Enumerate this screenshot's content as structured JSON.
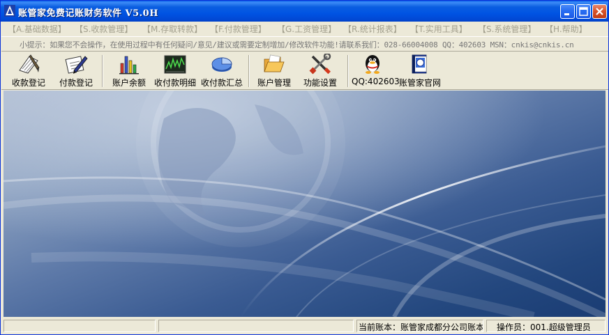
{
  "window": {
    "title": "账管家免费记账财务软件  V5.0H"
  },
  "menu": [
    {
      "label": "【A.基础数据】"
    },
    {
      "label": "【S.收款管理】"
    },
    {
      "label": "【M.存取转款】"
    },
    {
      "label": "【F.付款管理】"
    },
    {
      "label": "【G.工资管理】"
    },
    {
      "label": "【R.统计报表】"
    },
    {
      "label": "【T.实用工具】"
    },
    {
      "label": "【S.系统管理】"
    },
    {
      "label": "【H.帮助】"
    }
  ],
  "hint": {
    "text": "小提示：如果您不会操作，在使用过程中有任何疑问/意见/建议或需要定制增加/修改软件功能!请联系我们：028-66004008 QQ：402603 MSN：cnkis@cnkis.cn"
  },
  "toolbar": [
    {
      "label": "收款登记",
      "icon": "receipt-register-icon"
    },
    {
      "label": "付款登记",
      "icon": "payment-register-icon"
    },
    {
      "label": "账户余额",
      "icon": "bar-chart-icon"
    },
    {
      "label": "收付款明细",
      "icon": "line-chart-icon"
    },
    {
      "label": "收付款汇总",
      "icon": "pie-chart-icon"
    },
    {
      "label": "账户管理",
      "icon": "folder-icon"
    },
    {
      "label": "功能设置",
      "icon": "tools-icon"
    },
    {
      "label": "QQ:402603",
      "icon": "qq-penguin-icon"
    },
    {
      "label": "账管家官网",
      "icon": "website-book-icon"
    }
  ],
  "status": {
    "panel1": "",
    "panel2": "",
    "account": "当前账本：账管家成都分公司账本",
    "operator": "操作员：001.超级管理员"
  },
  "colors": {
    "titlebar": "#0054e3",
    "menu_text": "#a3a08e",
    "background": "#ece9d8",
    "main_dark": "#1a3c73"
  }
}
